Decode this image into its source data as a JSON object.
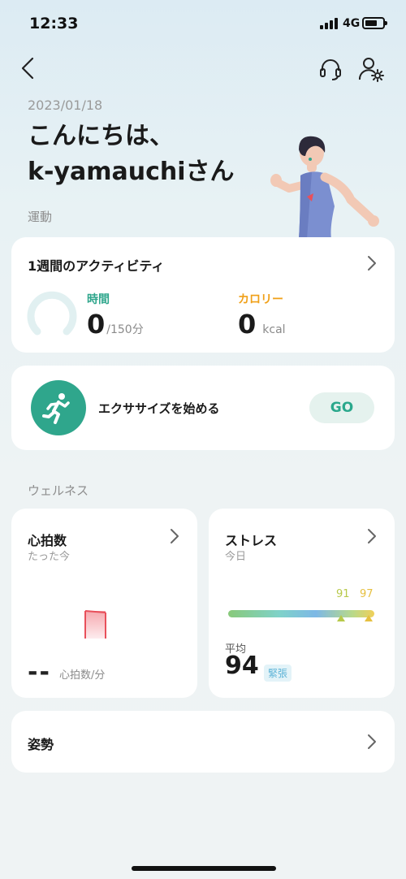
{
  "status": {
    "time": "12:33",
    "network": "4G"
  },
  "header": {
    "date": "2023/01/18",
    "greeting_line1": "こんにちは、",
    "greeting_line2": "k-yamauchiさん"
  },
  "sections": {
    "exercise": "運動",
    "wellness": "ウェルネス"
  },
  "activity": {
    "title": "1週間のアクティビティ",
    "time_label": "時間",
    "time_value": "0",
    "time_goal": "/150分",
    "calorie_label": "カロリー",
    "calorie_value": "0",
    "calorie_unit": "kcal",
    "progress": 0
  },
  "exercise": {
    "label": "エクササイズを始める",
    "button": "GO"
  },
  "heart_rate": {
    "title": "心拍数",
    "sub": "たった今",
    "value": "--",
    "unit": "心拍数/分"
  },
  "stress": {
    "title": "ストレス",
    "sub": "今日",
    "marker1": "91",
    "marker2": "97",
    "avg_label": "平均",
    "avg_value": "94",
    "level": "緊張"
  },
  "posture": {
    "title": "姿勢"
  },
  "colors": {
    "teal": "#2fa68c",
    "orange": "#f0a018",
    "stress_marker": "#b7c94a",
    "heart_red": "#e8505b"
  },
  "icons": [
    "back-arrow-icon",
    "headset-icon",
    "user-settings-icon",
    "runner-illustration",
    "running-person-icon",
    "chevron-right-icon",
    "heart-rate-bar-icon"
  ]
}
